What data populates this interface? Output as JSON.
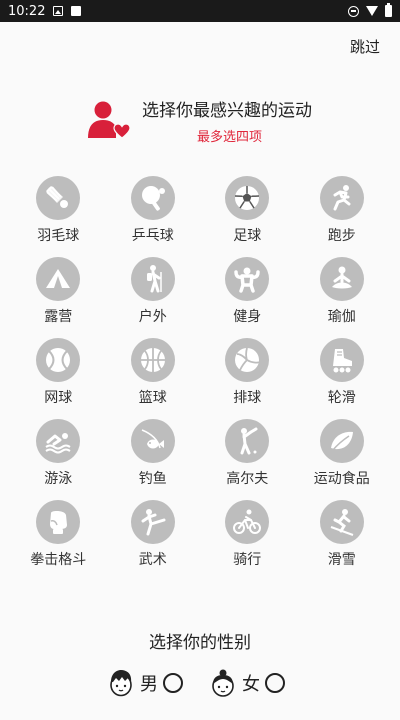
{
  "status_bar": {
    "time": "10:22"
  },
  "header": {
    "skip_label": "跳过"
  },
  "prompt": {
    "title": "选择你最感兴趣的运动",
    "subtitle": "最多选四项"
  },
  "sports": [
    {
      "label": "羽毛球",
      "icon": "badminton-icon"
    },
    {
      "label": "乒乓球",
      "icon": "ping-pong-icon"
    },
    {
      "label": "足球",
      "icon": "soccer-icon"
    },
    {
      "label": "跑步",
      "icon": "running-icon"
    },
    {
      "label": "露营",
      "icon": "tent-icon"
    },
    {
      "label": "户外",
      "icon": "hiking-icon"
    },
    {
      "label": "健身",
      "icon": "fitness-icon"
    },
    {
      "label": "瑜伽",
      "icon": "yoga-icon"
    },
    {
      "label": "网球",
      "icon": "tennis-icon"
    },
    {
      "label": "篮球",
      "icon": "basketball-icon"
    },
    {
      "label": "排球",
      "icon": "volleyball-icon"
    },
    {
      "label": "轮滑",
      "icon": "roller-skate-icon"
    },
    {
      "label": "游泳",
      "icon": "swimming-icon"
    },
    {
      "label": "钓鱼",
      "icon": "fishing-icon"
    },
    {
      "label": "高尔夫",
      "icon": "golf-icon"
    },
    {
      "label": "运动食品",
      "icon": "leaf-icon"
    },
    {
      "label": "拳击格斗",
      "icon": "boxing-glove-icon"
    },
    {
      "label": "武术",
      "icon": "martial-arts-icon"
    },
    {
      "label": "骑行",
      "icon": "cycling-icon"
    },
    {
      "label": "滑雪",
      "icon": "skiing-icon"
    }
  ],
  "gender": {
    "title": "选择你的性别",
    "male_label": "男",
    "female_label": "女",
    "selected": null
  },
  "colors": {
    "accent": "#e0263a",
    "icon_bg": "#bdbdbd",
    "status_bar": "#1a1a1a"
  }
}
